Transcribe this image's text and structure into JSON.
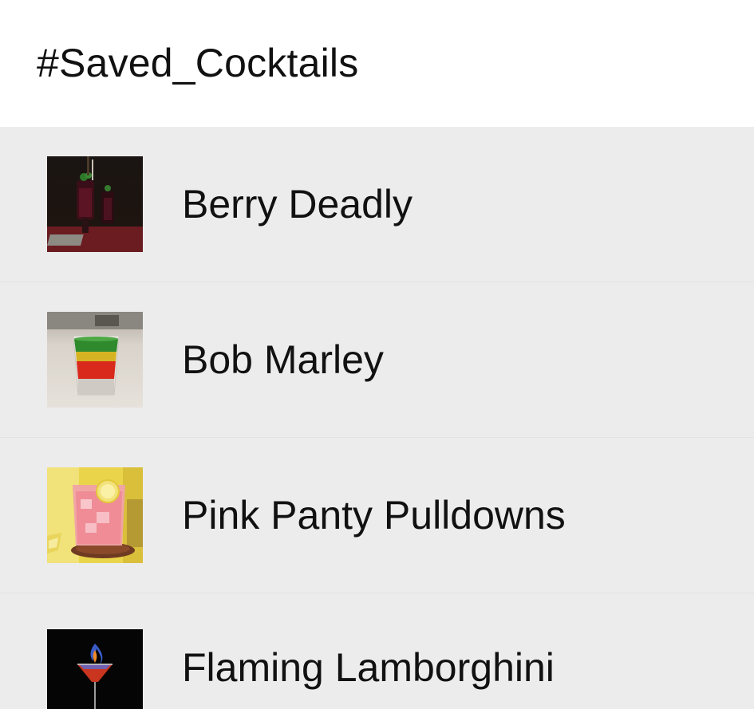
{
  "header": {
    "title": "#Saved_Cocktails"
  },
  "cocktails": [
    {
      "name": "Berry Deadly",
      "image": "berry-deadly-photo"
    },
    {
      "name": "Bob Marley",
      "image": "bob-marley-photo"
    },
    {
      "name": "Pink Panty Pulldowns",
      "image": "pink-panty-pulldowns-photo"
    },
    {
      "name": "Flaming Lamborghini",
      "image": "flaming-lamborghini-photo"
    }
  ]
}
